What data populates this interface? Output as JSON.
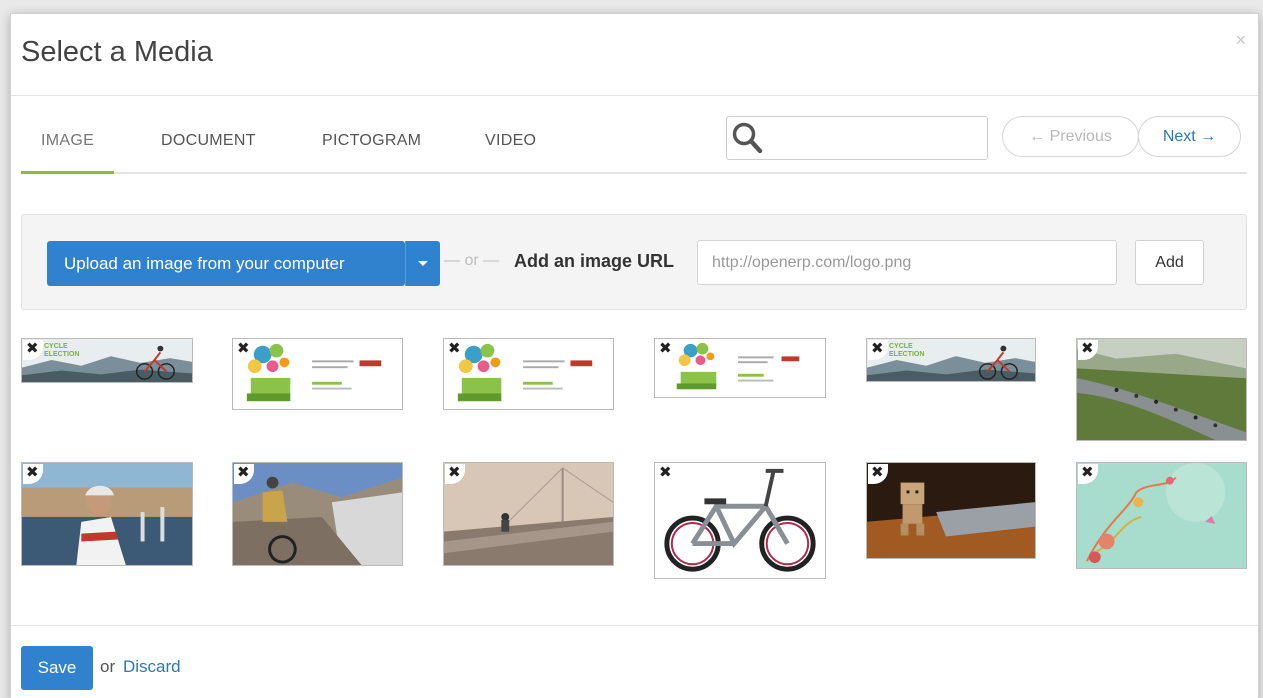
{
  "dialog": {
    "title": "Select a Media",
    "close": "×"
  },
  "tabs": [
    {
      "label": "IMAGE",
      "active": true
    },
    {
      "label": "DOCUMENT",
      "active": false
    },
    {
      "label": "PICTOGRAM",
      "active": false
    },
    {
      "label": "VIDEO",
      "active": false
    }
  ],
  "search": {
    "placeholder": "",
    "value": ""
  },
  "pager": {
    "previous": "← Previous",
    "next": "Next →"
  },
  "upload": {
    "button_label": "Upload an image from your computer",
    "separator": "— or —",
    "url_label": "Add an image URL",
    "url_placeholder": "http://openerp.com/logo.png",
    "add_label": "Add"
  },
  "images": [
    {
      "kind": "cycle-banner",
      "banner_text": "CYCLE ELECTION"
    },
    {
      "kind": "balloon-banner"
    },
    {
      "kind": "balloon-banner"
    },
    {
      "kind": "balloon-banner"
    },
    {
      "kind": "cycle-banner",
      "banner_text": "CYCLE ELECTION"
    },
    {
      "kind": "road-race-photo"
    },
    {
      "kind": "cyclist-harbor-photo"
    },
    {
      "kind": "mountain-biker-photo"
    },
    {
      "kind": "bridge-cyclist-photo"
    },
    {
      "kind": "bmx-bike-photo"
    },
    {
      "kind": "robot-figure-photo"
    },
    {
      "kind": "floral-texture"
    }
  ],
  "remove_icon": "✖",
  "footer": {
    "save_label": "Save",
    "or_text": "or",
    "discard_label": "Discard"
  },
  "colors": {
    "primary": "#3182ce",
    "active_tab": "#8abb3a",
    "link": "#2a79b8"
  }
}
